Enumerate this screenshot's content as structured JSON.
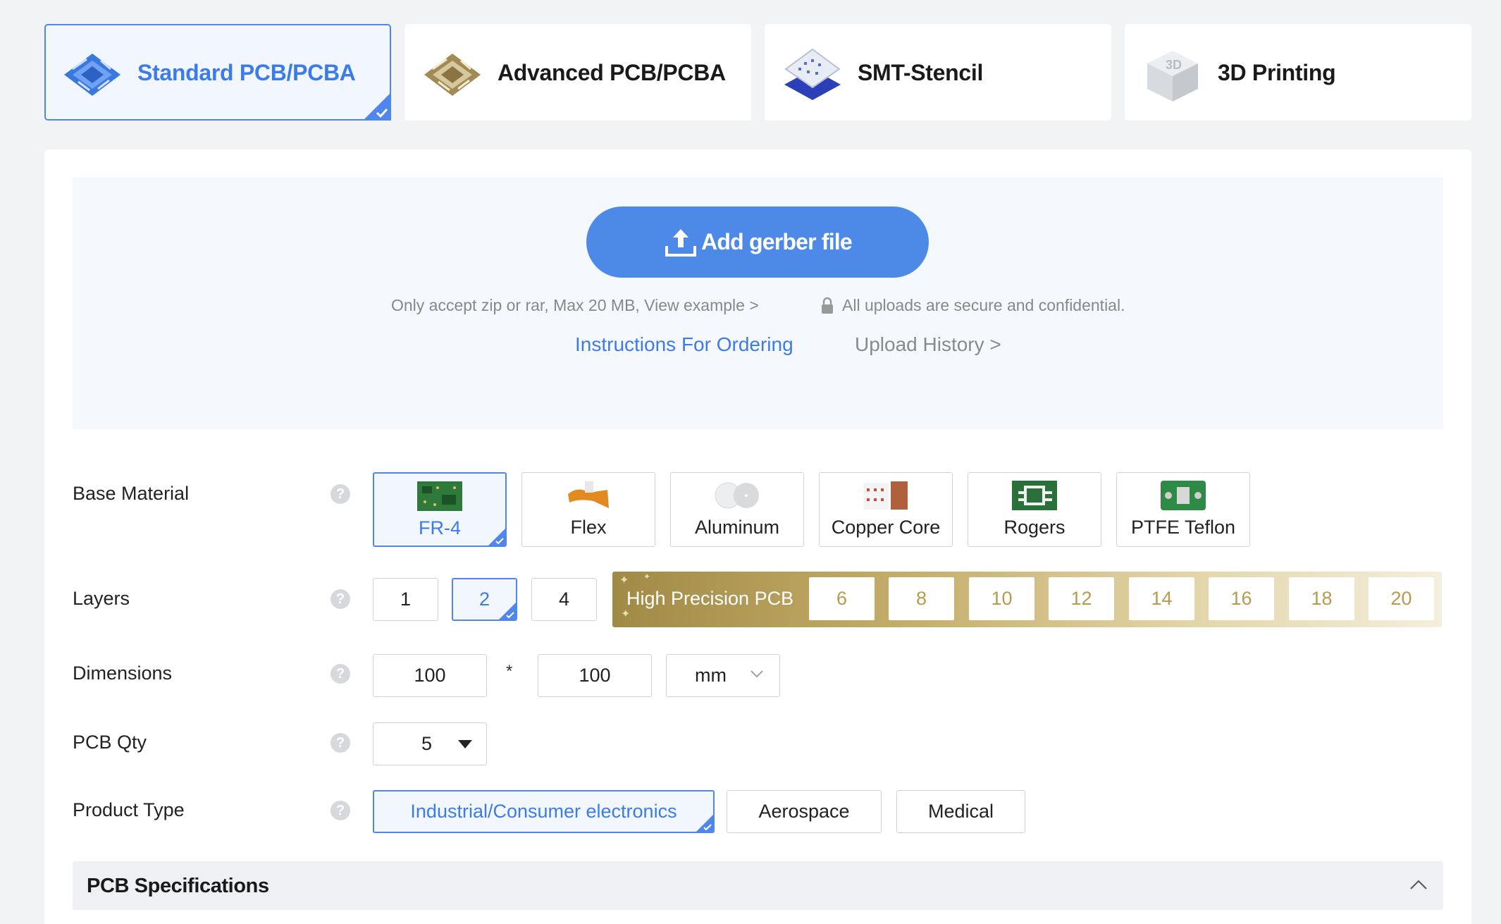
{
  "service_tabs": [
    {
      "label": "Standard PCB/PCBA",
      "icon": "pcb-chip-blue-icon",
      "selected": true
    },
    {
      "label": "Advanced PCB/PCBA",
      "icon": "pcb-chip-gold-icon",
      "selected": false
    },
    {
      "label": "SMT-Stencil",
      "icon": "smt-stencil-icon",
      "selected": false
    },
    {
      "label": "3D Printing",
      "icon": "3d-cube-icon",
      "selected": false
    }
  ],
  "upload": {
    "button_label": "Add gerber file",
    "note": "Only accept zip or rar, Max 20 MB, View example >",
    "secure_note": "All uploads are secure and confidential.",
    "instructions_link": "Instructions For Ordering",
    "history_link": "Upload History >"
  },
  "form": {
    "base_material": {
      "label": "Base Material",
      "options": [
        "FR-4",
        "Flex",
        "Aluminum",
        "Copper Core",
        "Rogers",
        "PTFE Teflon"
      ],
      "selected": "FR-4"
    },
    "layers": {
      "label": "Layers",
      "options": [
        "1",
        "2",
        "4"
      ],
      "selected": "2",
      "high_precision_label": "High Precision PCB",
      "high_precision_options": [
        "6",
        "8",
        "10",
        "12",
        "14",
        "16",
        "18",
        "20"
      ]
    },
    "dimensions": {
      "label": "Dimensions",
      "width": "100",
      "separator": "*",
      "height": "100",
      "unit": "mm"
    },
    "pcb_qty": {
      "label": "PCB Qty",
      "value": "5"
    },
    "product_type": {
      "label": "Product Type",
      "options": [
        "Industrial/Consumer electronics",
        "Aerospace",
        "Medical"
      ],
      "selected": "Industrial/Consumer electronics"
    }
  },
  "spec_section": {
    "title": "PCB Specifications",
    "expanded": true
  },
  "colors": {
    "accent": "#4d8ae8",
    "link": "#3d7ce8",
    "gold": "#b89a4e"
  }
}
